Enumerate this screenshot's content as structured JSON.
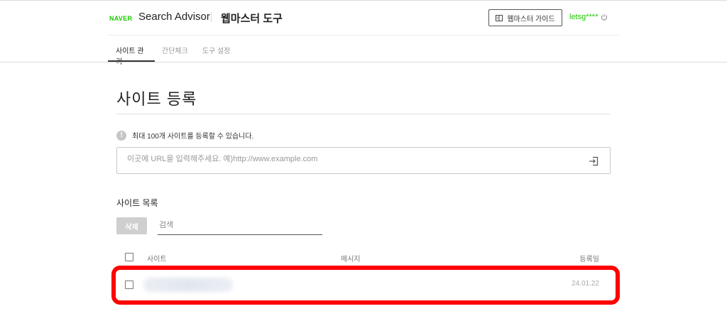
{
  "header": {
    "logo": "NAVER",
    "brand": "Search Advisor",
    "tool_title": "웹마스터 도구",
    "guide_button": "웹마스터 가이드",
    "user": "letsg****"
  },
  "tabs": [
    {
      "label": "사이트 관리",
      "active": true
    },
    {
      "label": "간단체크",
      "active": false
    },
    {
      "label": "도구 설정",
      "active": false
    }
  ],
  "page": {
    "title": "사이트 등록",
    "notice": "최대 100개 사이트를 등록할 수 있습니다.",
    "url_placeholder": "이곳에 URL을 입력해주세요. 예)http://www.example.com"
  },
  "site_list": {
    "title": "사이트 목록",
    "delete_button": "삭제",
    "search_placeholder": "검색",
    "columns": {
      "site": "사이트",
      "message": "메시지",
      "date": "등록일"
    },
    "rows": [
      {
        "site": "",
        "message": "",
        "date": "24.01.22"
      }
    ]
  },
  "colors": {
    "naver_green": "#1ec800",
    "highlight": "#ff0000"
  }
}
